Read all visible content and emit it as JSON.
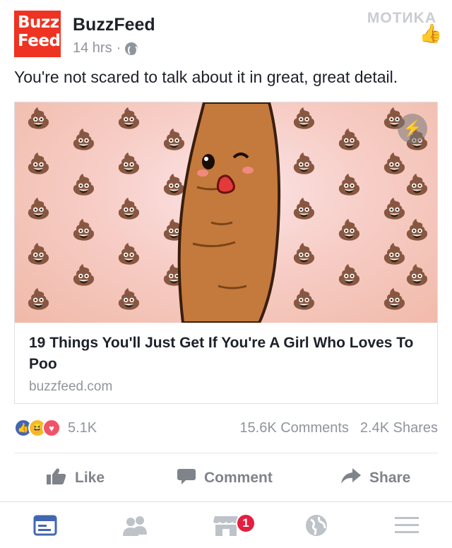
{
  "post": {
    "page_name": "BuzzFeed",
    "logo_line1": "Buzz",
    "logo_line2": "Feed",
    "time": "14 hrs",
    "separator": "·",
    "message": "You're not scared to talk about it in great, great detail."
  },
  "watermark": "MOTИKA",
  "link_card": {
    "title": "19 Things You'll Just Get If You're A Girl Who Loves To Poo",
    "domain": "buzzfeed.com"
  },
  "reactions": {
    "count": "5.1K",
    "comments": "15.6K Comments",
    "shares": "2.4K Shares"
  },
  "actions": {
    "like": "Like",
    "comment": "Comment",
    "share": "Share"
  },
  "tab_bar": {
    "badge": "1",
    "active_color": "#4267b2",
    "inactive_color": "#bec2c9"
  },
  "icons": [
    "globe-icon",
    "lightning-icon",
    "like-icon",
    "comment-icon",
    "share-icon",
    "news-feed-icon",
    "friends-icon",
    "marketplace-icon",
    "globe-notifications-icon",
    "menu-icon"
  ]
}
